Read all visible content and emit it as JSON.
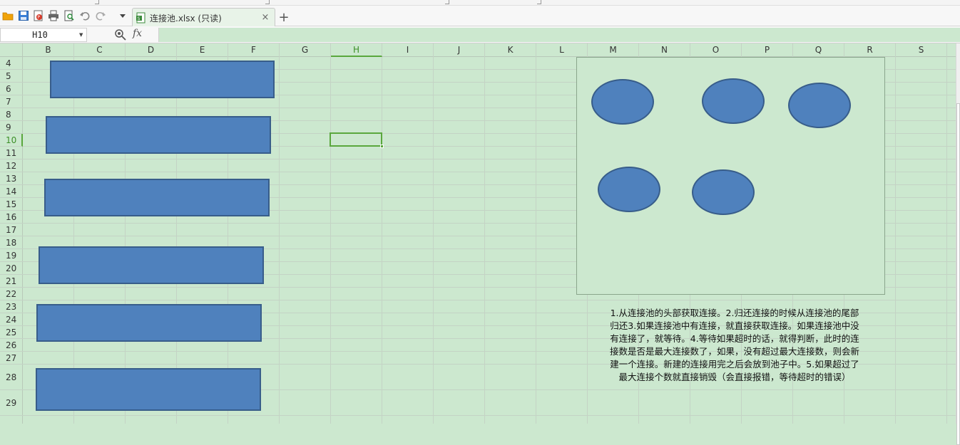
{
  "toolbar": {
    "icons": [
      "open-folder-icon",
      "save-icon",
      "export-pdf-icon",
      "print-icon",
      "print-preview-icon",
      "undo-icon",
      "redo-icon",
      "dropdown-icon"
    ]
  },
  "tab": {
    "title": "连接池.xlsx (只读)",
    "close": "×",
    "new_tab": "+"
  },
  "formula_bar": {
    "cell_ref": "H10",
    "fx": "fx",
    "formula": ""
  },
  "columns": [
    "B",
    "C",
    "D",
    "E",
    "F",
    "G",
    "H",
    "I",
    "J",
    "K",
    "L",
    "M",
    "N",
    "O",
    "P",
    "Q",
    "R",
    "S"
  ],
  "active_column": "H",
  "rows": [
    "4",
    "5",
    "6",
    "7",
    "8",
    "9",
    "10",
    "11",
    "12",
    "13",
    "14",
    "15",
    "16",
    "17",
    "18",
    "19",
    "20",
    "21",
    "22",
    "23",
    "24",
    "25",
    "26",
    "27",
    "28",
    "29"
  ],
  "active_row": "10",
  "note": {
    "lines": [
      "1.从连接池的头部获取连接。2.归还连接的时候从连接池的尾部",
      "归还3.如果连接池中有连接，就直接获取连接。如果连接池中没",
      "有连接了，就等待。4.等待如果超时的话，就得判断，此时的连",
      "接数是否是最大连接数了，如果，没有超过最大连接数，则会新",
      "建一个连接。新建的连接用完之后会放到池子中。5.如果超过了",
      "最大连接个数就直接销毁（会直接报错，等待超时的错误）"
    ]
  },
  "colors": {
    "sheet_bg": "#cce8cf",
    "shape_fill": "#4f81bd",
    "shape_border": "#385d8a",
    "selection": "#5aa73d"
  }
}
